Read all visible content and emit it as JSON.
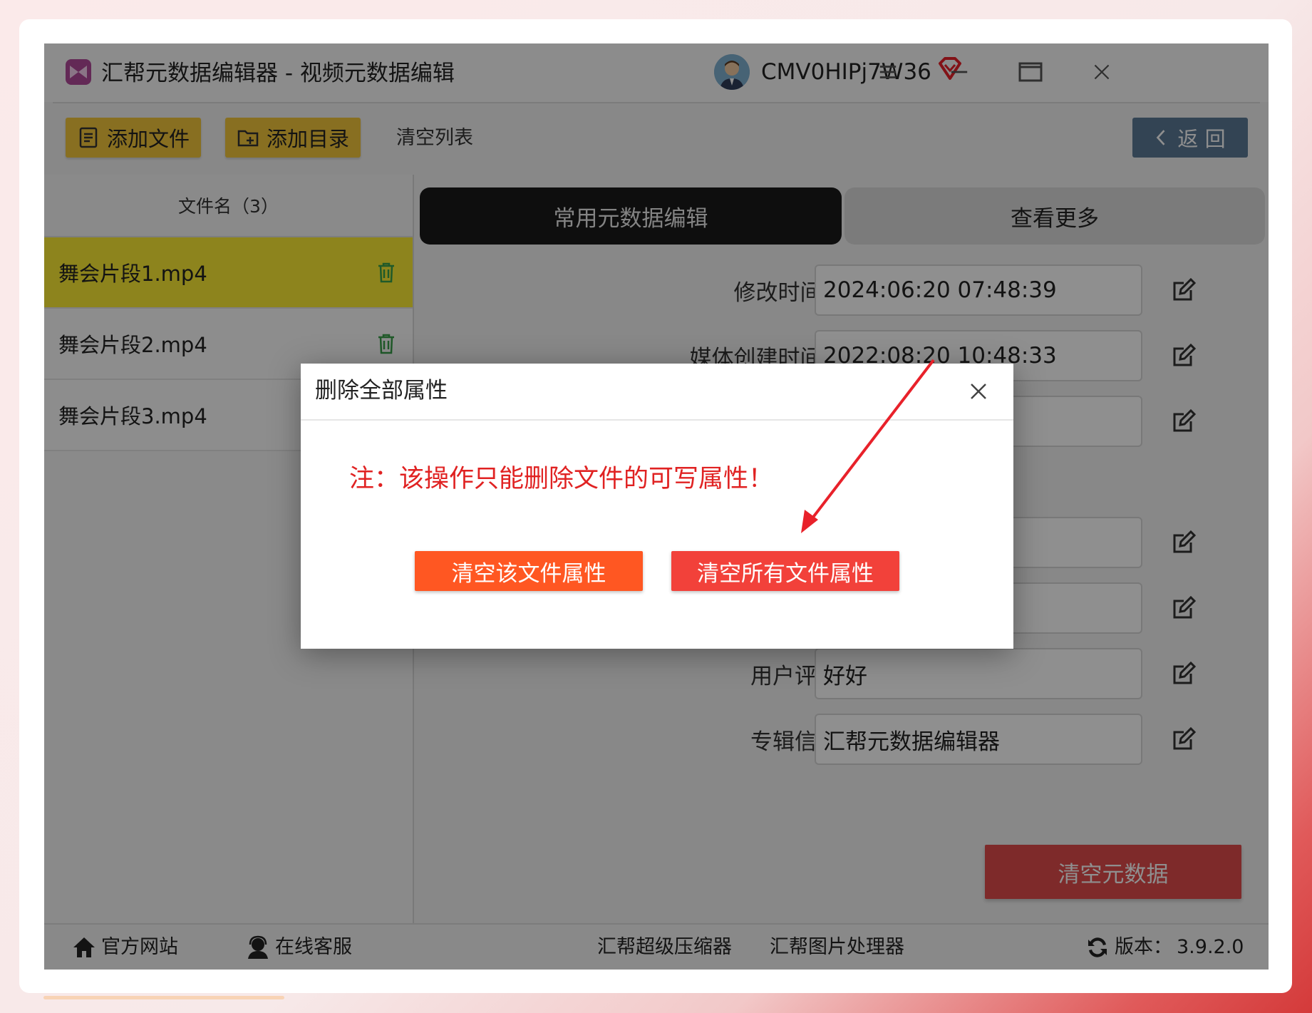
{
  "app": {
    "title": "汇帮元数据编辑器 - 视频元数据编辑",
    "user_name": "CMV0HIPj7W36"
  },
  "toolbar": {
    "add_file": "添加文件",
    "add_dir": "添加目录",
    "clear_list": "清空列表",
    "back": "返 回"
  },
  "file_list": {
    "header": "文件名（3）",
    "items": [
      {
        "name": "舞会片段1.mp4"
      },
      {
        "name": "舞会片段2.mp4"
      },
      {
        "name": "舞会片段3.mp4"
      }
    ]
  },
  "tabs": {
    "common": "常用元数据编辑",
    "more": "查看更多"
  },
  "fields": [
    {
      "label": "修改时间",
      "help": "?",
      "value": "2024:06:20 07:48:39"
    },
    {
      "label": "媒体创建时间",
      "help": "?",
      "value": "2022:08:20 10:48:33"
    },
    {
      "label": "",
      "value": ""
    },
    {
      "label": "",
      "value": ""
    },
    {
      "label": "",
      "value": ""
    },
    {
      "label": "用户评论：",
      "value": "好好"
    },
    {
      "label": "专辑信息：",
      "value": "汇帮元数据编辑器"
    }
  ],
  "clear_meta": "清空元数据",
  "footer": {
    "website": "官方网站",
    "service": "在线客服",
    "compressor": "汇帮超级压缩器",
    "image_tool": "汇帮图片处理器",
    "version_label": "版本：",
    "version": "3.9.2.0"
  },
  "dialog": {
    "title": "删除全部属性",
    "note": "注：该操作只能删除文件的可写属性！",
    "btn_clear_one": "清空该文件属性",
    "btn_clear_all": "清空所有文件属性"
  },
  "colors": {
    "accent_yellow": "#f3c63c",
    "selected_row": "#fbeb35",
    "back_button": "#5b7a96",
    "danger": "#e14b4b",
    "dialog_note": "#e02222",
    "dialog_btn_one": "#ff5722",
    "dialog_btn_all": "#f2413a"
  }
}
